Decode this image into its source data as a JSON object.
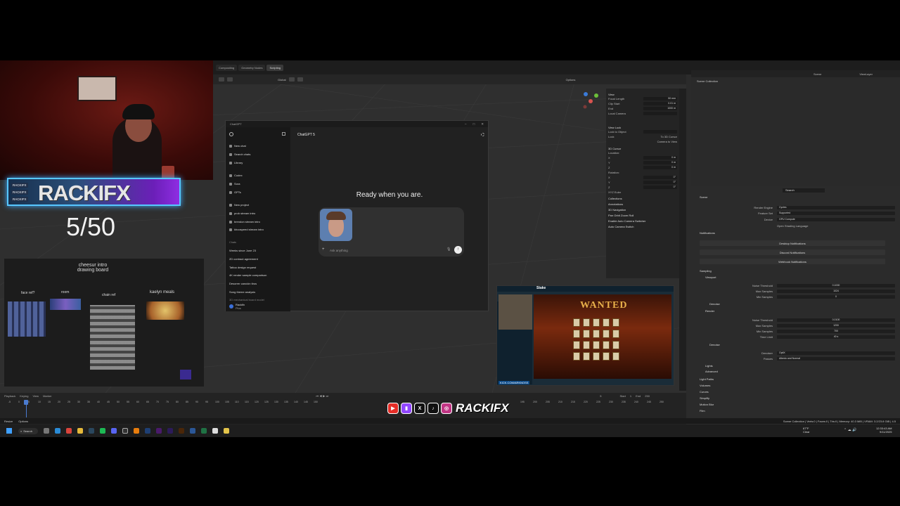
{
  "blender": {
    "workspace_tabs": [
      "Compositing",
      "Geometry Nodes",
      "Scripting"
    ],
    "viewport_header": {
      "orientation": "Global",
      "options_label": "Options"
    },
    "outliner": {
      "title": "Scene Collection",
      "scene_label": "Scene",
      "view_layer_label": "ViewLayer"
    },
    "npanel": {
      "view_header": "View",
      "focal_length_label": "Focal Length",
      "focal_length_value": "50 mm",
      "clip_start_label": "Clip Start",
      "clip_start_value": "0.01 m",
      "clip_end_label": "End",
      "clip_end_value": "1000 m",
      "local_camera_label": "Local Camera",
      "view_lock_header": "View Lock",
      "lock_object_label": "Lock to Object",
      "lock_label": "Lock",
      "lock_to_3d_cursor": "To 3D Cursor",
      "camera_to_view": "Camera to View",
      "cursor_header": "3D Cursor",
      "location_label": "Location:",
      "x_label": "X",
      "y_label": "Y",
      "z_label": "Z",
      "zero_m": "0 m",
      "rotation_label": "Rotation:",
      "zero_deg": "0°",
      "rotation_mode": "XYZ Euler",
      "collections": "Collections",
      "annotations": "Annotations",
      "navigation": "3D Navigation",
      "pan_orbit": "Pan Orbit Zoom Roll",
      "auto_camera_switcher": "Enable Auto Camera Switcher",
      "auto_camera_switch": "Auto Camera Switch"
    },
    "properties": {
      "search_placeholder": "Search",
      "scene_label": "Scene",
      "render_engine_label": "Render Engine",
      "render_engine_value": "Cycles",
      "feature_set_label": "Feature Set",
      "feature_set_value": "Supported",
      "device_label": "Device",
      "device_value": "GPU Compute",
      "osl_label": "Open Shading Language",
      "notifications_label": "Notifications",
      "desktop_notifications": "Desktop Notifications",
      "discord_notifications": "Discord Notifications",
      "webhook_notifications": "Webhook Notifications",
      "sampling_label": "Sampling",
      "viewport_label": "Viewport",
      "noise_threshold_label": "Noise Threshold",
      "vp_noise_threshold": "0.1000",
      "max_samples_label": "Max Samples",
      "vp_max_samples": "1024",
      "min_samples_label": "Min Samples",
      "vp_min_samples": "0",
      "denoise_label": "Denoise",
      "render_label": "Render",
      "r_noise_threshold": "0.0100",
      "r_max_samples": "1200",
      "r_min_samples": "700",
      "time_limit_label": "Time Limit",
      "time_limit_value": "40 s",
      "denoiser_label": "Denoiser",
      "denoiser_value": "OptiX",
      "passes_label": "Passes",
      "passes_value": "Albedo and Normal",
      "lights_label": "Lights",
      "advanced_label": "Advanced",
      "light_paths_label": "Light Paths",
      "volumes_label": "Volumes",
      "curves_label": "Curves",
      "simplify_label": "Simplify",
      "motion_blur_label": "Motion Blur",
      "film_label": "Film"
    },
    "timeline": {
      "menu": [
        "Playback",
        "Keying",
        "View",
        "Marker"
      ],
      "start_label": "Start",
      "start_value": "1",
      "end_label": "End",
      "end_value": "250",
      "current_frame": "5",
      "ticks": [
        "-5",
        "0",
        "5",
        "10",
        "15",
        "20",
        "25",
        "30",
        "35",
        "40",
        "45",
        "50",
        "55",
        "60",
        "65",
        "70",
        "75",
        "80",
        "85",
        "90",
        "95",
        "100",
        "105",
        "110",
        "115",
        "120",
        "125",
        "130",
        "135",
        "140",
        "145",
        "150"
      ],
      "ticks_right": [
        "195",
        "200",
        "205",
        "210",
        "215",
        "220",
        "225",
        "230",
        "235",
        "240",
        "245",
        "250"
      ]
    },
    "status": {
      "left_items": [
        "Resize",
        "Options"
      ],
      "right": "Scene Collection | Verts:0 | Faces:0 | Tris:0 | Memory: 40.3 MiB | VRAM: 3.2/23.8 GiB | 4.5"
    }
  },
  "overlay": {
    "logo_text": "RACKIFX",
    "handles": [
      "RACKIFX",
      "RACKIFX",
      "RACKIFX"
    ],
    "counter": "5/50",
    "moodboard": {
      "title": "cheesur intro drawing board",
      "labels": {
        "face_ref": "face ref?",
        "room": "room",
        "chain_ref": "chain ref",
        "kaelyn_meals": "kaelyn meals"
      }
    },
    "social_name": "RACKIFX",
    "social_icons": [
      "youtube-icon",
      "twitch-icon",
      "x-icon",
      "tiktok-icon",
      "instagram-icon"
    ]
  },
  "chatgpt": {
    "window_title": "ChatGPT",
    "model_label": "ChatGPT 5",
    "nav": [
      "New chat",
      "Search chats",
      "Library"
    ],
    "apps": [
      "Codex",
      "Sora",
      "GPTs"
    ],
    "projects_new": "New project",
    "projects": [
      "prob stream intro",
      "brendon stream intro",
      "khoospeed stream intro"
    ],
    "chats_header": "Chats",
    "chats": [
      "Weeks since June 23",
      "2D contract agreement",
      "Tattoo design request",
      "4K render sample comparison",
      "Desorrer canción tiros",
      "Song theme analysis",
      "3D mechanical board model"
    ],
    "user_name": "Rackifx",
    "user_plan": "Plus",
    "heading": "Ready when you are.",
    "input_placeholder": "Ask anything"
  },
  "slots": {
    "brand": "Stake",
    "game_title": "WANTED",
    "url": "KICK.COM/ARKNOSS"
  },
  "taskbar": {
    "search_label": "Search",
    "weather_temp": "67°F",
    "weather_desc": "Clear",
    "time": "12:33:43 AM",
    "date": "9/11/2025"
  }
}
